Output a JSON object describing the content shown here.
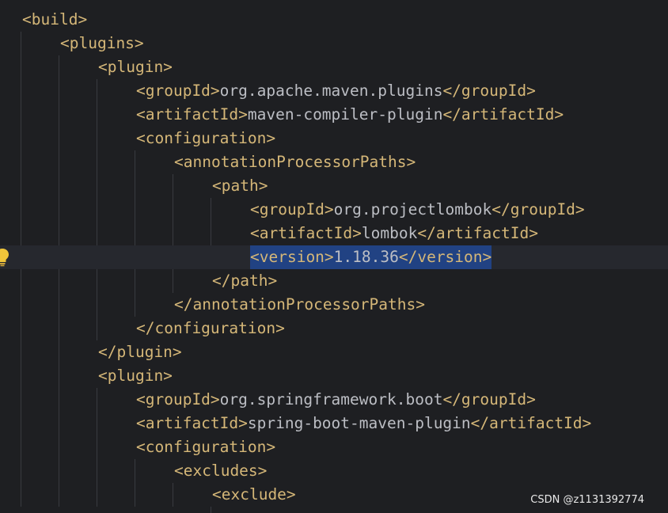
{
  "editor": {
    "language": "xml",
    "lines": [
      {
        "indent": 0,
        "parts": [
          {
            "k": "tag",
            "t": "<build>"
          }
        ]
      },
      {
        "indent": 1,
        "parts": [
          {
            "k": "tag",
            "t": "<plugins>"
          }
        ]
      },
      {
        "indent": 2,
        "parts": [
          {
            "k": "tag",
            "t": "<plugin>"
          }
        ]
      },
      {
        "indent": 3,
        "parts": [
          {
            "k": "tag",
            "t": "<groupId>"
          },
          {
            "k": "txt",
            "t": "org.apache.maven.plugins"
          },
          {
            "k": "tag",
            "t": "</groupId>"
          }
        ]
      },
      {
        "indent": 3,
        "parts": [
          {
            "k": "tag",
            "t": "<artifactId>"
          },
          {
            "k": "txt",
            "t": "maven-compiler-plugin"
          },
          {
            "k": "tag",
            "t": "</artifactId>"
          }
        ]
      },
      {
        "indent": 3,
        "parts": [
          {
            "k": "tag",
            "t": "<configuration>"
          }
        ]
      },
      {
        "indent": 4,
        "parts": [
          {
            "k": "tag",
            "t": "<annotationProcessorPaths>"
          }
        ]
      },
      {
        "indent": 5,
        "parts": [
          {
            "k": "tag",
            "t": "<path>"
          }
        ]
      },
      {
        "indent": 6,
        "parts": [
          {
            "k": "tag",
            "t": "<groupId>"
          },
          {
            "k": "txt",
            "t": "org.projectlombok"
          },
          {
            "k": "tag",
            "t": "</groupId>"
          }
        ]
      },
      {
        "indent": 6,
        "parts": [
          {
            "k": "tag",
            "t": "<artifactId>"
          },
          {
            "k": "txt",
            "t": "lombok"
          },
          {
            "k": "tag",
            "t": "</artifactId>"
          }
        ]
      },
      {
        "indent": 6,
        "current": true,
        "selected": true,
        "parts": [
          {
            "k": "tag",
            "t": "<version>"
          },
          {
            "k": "txt",
            "t": "1.18.36"
          },
          {
            "k": "tag",
            "t": "</version>"
          }
        ]
      },
      {
        "indent": 5,
        "parts": [
          {
            "k": "tag",
            "t": "</path>"
          }
        ]
      },
      {
        "indent": 4,
        "parts": [
          {
            "k": "tag",
            "t": "</annotationProcessorPaths>"
          }
        ]
      },
      {
        "indent": 3,
        "parts": [
          {
            "k": "tag",
            "t": "</configuration>"
          }
        ]
      },
      {
        "indent": 2,
        "parts": [
          {
            "k": "tag",
            "t": "</plugin>"
          }
        ]
      },
      {
        "indent": 2,
        "parts": [
          {
            "k": "tag",
            "t": "<plugin>"
          }
        ]
      },
      {
        "indent": 3,
        "parts": [
          {
            "k": "tag",
            "t": "<groupId>"
          },
          {
            "k": "txt",
            "t": "org.springframework.boot"
          },
          {
            "k": "tag",
            "t": "</groupId>"
          }
        ]
      },
      {
        "indent": 3,
        "parts": [
          {
            "k": "tag",
            "t": "<artifactId>"
          },
          {
            "k": "txt",
            "t": "spring-boot-maven-plugin"
          },
          {
            "k": "tag",
            "t": "</artifactId>"
          }
        ]
      },
      {
        "indent": 3,
        "parts": [
          {
            "k": "tag",
            "t": "<configuration>"
          }
        ]
      },
      {
        "indent": 4,
        "parts": [
          {
            "k": "tag",
            "t": "<excludes>"
          }
        ]
      },
      {
        "indent": 5,
        "parts": [
          {
            "k": "tag",
            "t": "<exclude>"
          }
        ]
      }
    ]
  },
  "gutter": {
    "intention_icon": "lightbulb-icon"
  },
  "watermark": "CSDN @z1131392774",
  "colors": {
    "background": "#1e1f22",
    "current_line": "#26282e",
    "selection": "#214283",
    "tag": "#d5b778",
    "text": "#bcbec4",
    "indent_guide": "#393b40",
    "bulb": "#f0c53a"
  }
}
